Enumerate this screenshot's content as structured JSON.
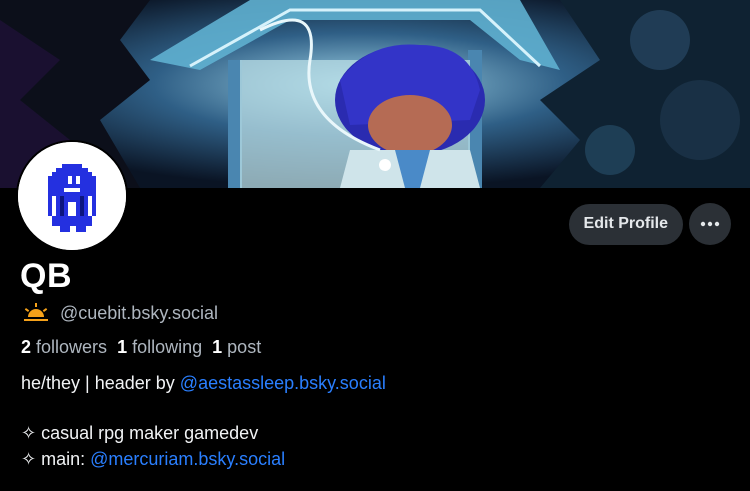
{
  "profile": {
    "display_name": "QB",
    "handle": "@cuebit.bsky.social",
    "handle_icon": "sunrise-icon",
    "stats": {
      "followers_count": "2",
      "followers_label": "followers",
      "following_count": "1",
      "following_label": "following",
      "posts_count": "1",
      "posts_label": "post"
    },
    "bio": {
      "line1_text": "he/they | header by ",
      "line1_link": "@aestassleep.bsky.social",
      "line3_text": "✧ casual rpg maker gamedev",
      "line4_text": "✧ main: ",
      "line4_link": "@mercuriam.bsky.social"
    }
  },
  "actions": {
    "edit_profile_label": "Edit Profile",
    "more_icon": "ellipsis-icon"
  },
  "colors": {
    "background": "#000000",
    "button_bg": "#2b3036",
    "muted_text": "#aeb6bf",
    "link": "#2a7fff",
    "avatar_sprite": "#2430e0"
  }
}
